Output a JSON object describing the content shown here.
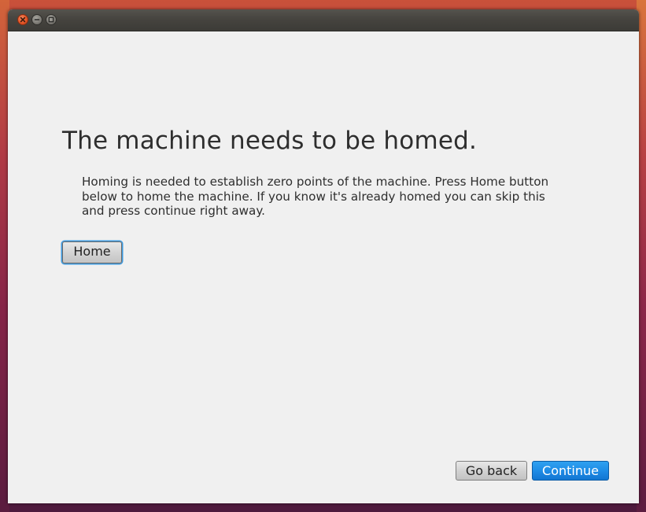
{
  "window": {
    "controls": {
      "close_icon": "close-icon",
      "minimize_icon": "minimize-icon",
      "maximize_icon": "maximize-icon"
    }
  },
  "main": {
    "heading": "The machine needs to be homed.",
    "description": "Homing is needed to establish zero points of the machine. Press Home button below to home the machine. If you know it's already homed you can skip this and press continue right away.",
    "home_button_label": "Home"
  },
  "footer": {
    "back_label": "Go back",
    "continue_label": "Continue"
  },
  "colors": {
    "background": "#f0f0f0",
    "text": "#2e2e2e",
    "accent": "#1e8ce6",
    "focus_ring": "#3d9ae0",
    "close_button": "#e45627",
    "titlebar": "#46443f"
  }
}
